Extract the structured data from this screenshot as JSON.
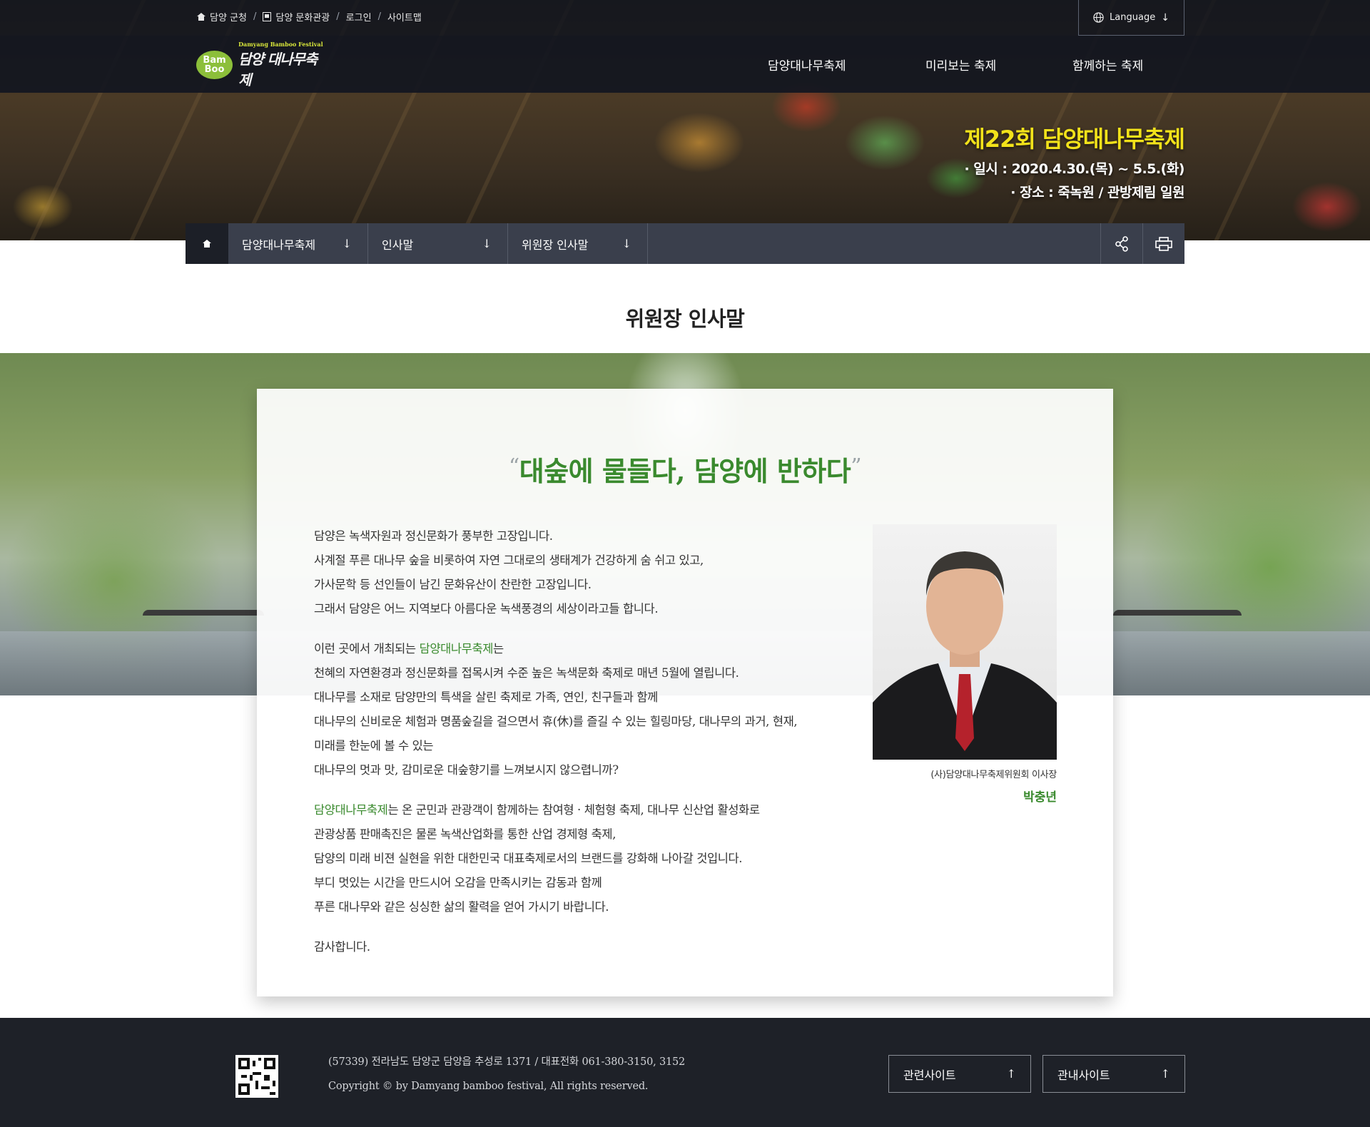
{
  "header": {
    "util_links": [
      {
        "label": "담양 군청",
        "icon": "home-icon"
      },
      {
        "label": "담양 문화관광",
        "icon": "tourism-icon"
      },
      {
        "label": "로그인"
      },
      {
        "label": "사이트맵"
      }
    ],
    "language_label": "Language",
    "logo": {
      "badge_line1": "Bam",
      "badge_line2": "Boo",
      "small_text": "Damyang Bamboo Festival",
      "title": "담양 대나무축제"
    },
    "nav": [
      "담양대나무축제",
      "미리보는 축제",
      "함께하는 축제"
    ]
  },
  "hero": {
    "festival_name": "제22회 담양대나무축제",
    "date_line": "· 일시 : 2020.4.30.(목) ~ 5.5.(화)",
    "place_line": "· 장소 : 죽녹원 / 관방제림 일원"
  },
  "location": {
    "items": [
      "담양대나무축제",
      "인사말",
      "위원장 인사말"
    ],
    "arrow": "↓",
    "tools": [
      "share-icon",
      "print-icon"
    ]
  },
  "content": {
    "page_title": "위원장 인사말",
    "quote_open": "“",
    "quote": "대숲에 물들다, 담양에 반하다",
    "quote_close": "”",
    "para1": [
      "담양은 녹색자원과 정신문화가 풍부한 고장입니다.",
      "사계절 푸른 대나무 숲을 비롯하여 자연 그대로의 생태계가 건강하게 숨 쉬고 있고,",
      "가사문학 등 선인들이 남긴 문화유산이 찬란한 고장입니다.",
      "그래서 담양은 어느 지역보다 아름다운 녹색풍경의 세상이라고들 합니다."
    ],
    "para2_lead": "이런 곳에서 개최되는 ",
    "para2_highlight": "담양대나무축제",
    "para2_tail": "는",
    "para2": [
      "천혜의 자연환경과 정신문화를 접목시켜 수준 높은 녹색문화 축제로 매년 5월에 열립니다.",
      "대나무를 소재로 담양만의 특색을 살린 축제로 가족, 연인, 친구들과 함께",
      "대나무의 신비로운 체험과 명품숲길을 걸으면서 휴(休)를 즐길 수 있는 힐링마당, 대나무의 과거, 현재,",
      "미래를 한눈에 볼 수 있는",
      "대나무의 멋과 맛, 감미로운 대숲향기를 느껴보시지 않으렵니까?"
    ],
    "para3_highlight": "담양대나무축제",
    "para3_tail": "는 온 군민과 관광객이 함께하는 참여형 · 체험형 축제, 대나무 신산업 활성화로",
    "para3": [
      "관광상품 판매촉진은 물론 녹색산업화를 통한 산업 경제형 축제,",
      "담양의 미래 비젼 실현을 위한 대한민국 대표축제로서의 브랜드를 강화해 나아갈 것입니다.",
      "부디 멋있는 시간을 만드시어 오감을 만족시키는 감동과 함께",
      "푸른 대나무와 같은 싱싱한 삶의 활력을 얻어 가시기 바랍니다."
    ],
    "closing": "감사합니다.",
    "caption": "(사)담양대나무축제위원회 이사장",
    "caption_name": "박충년"
  },
  "footer": {
    "address": "(57339) 전라남도 담양군 담양읍 추성로 1371   / 대표전화 061-380-3150, 3152",
    "copyright": "Copyright © by Damyang bamboo festival, All rights reserved.",
    "buttons": [
      "관련사이트",
      "관내사이트"
    ],
    "button_arrow": "↑"
  },
  "colors": {
    "accent_green": "#3a8a2e",
    "title_yellow": "#f2e21a",
    "dark_navy": "#1e2128"
  }
}
